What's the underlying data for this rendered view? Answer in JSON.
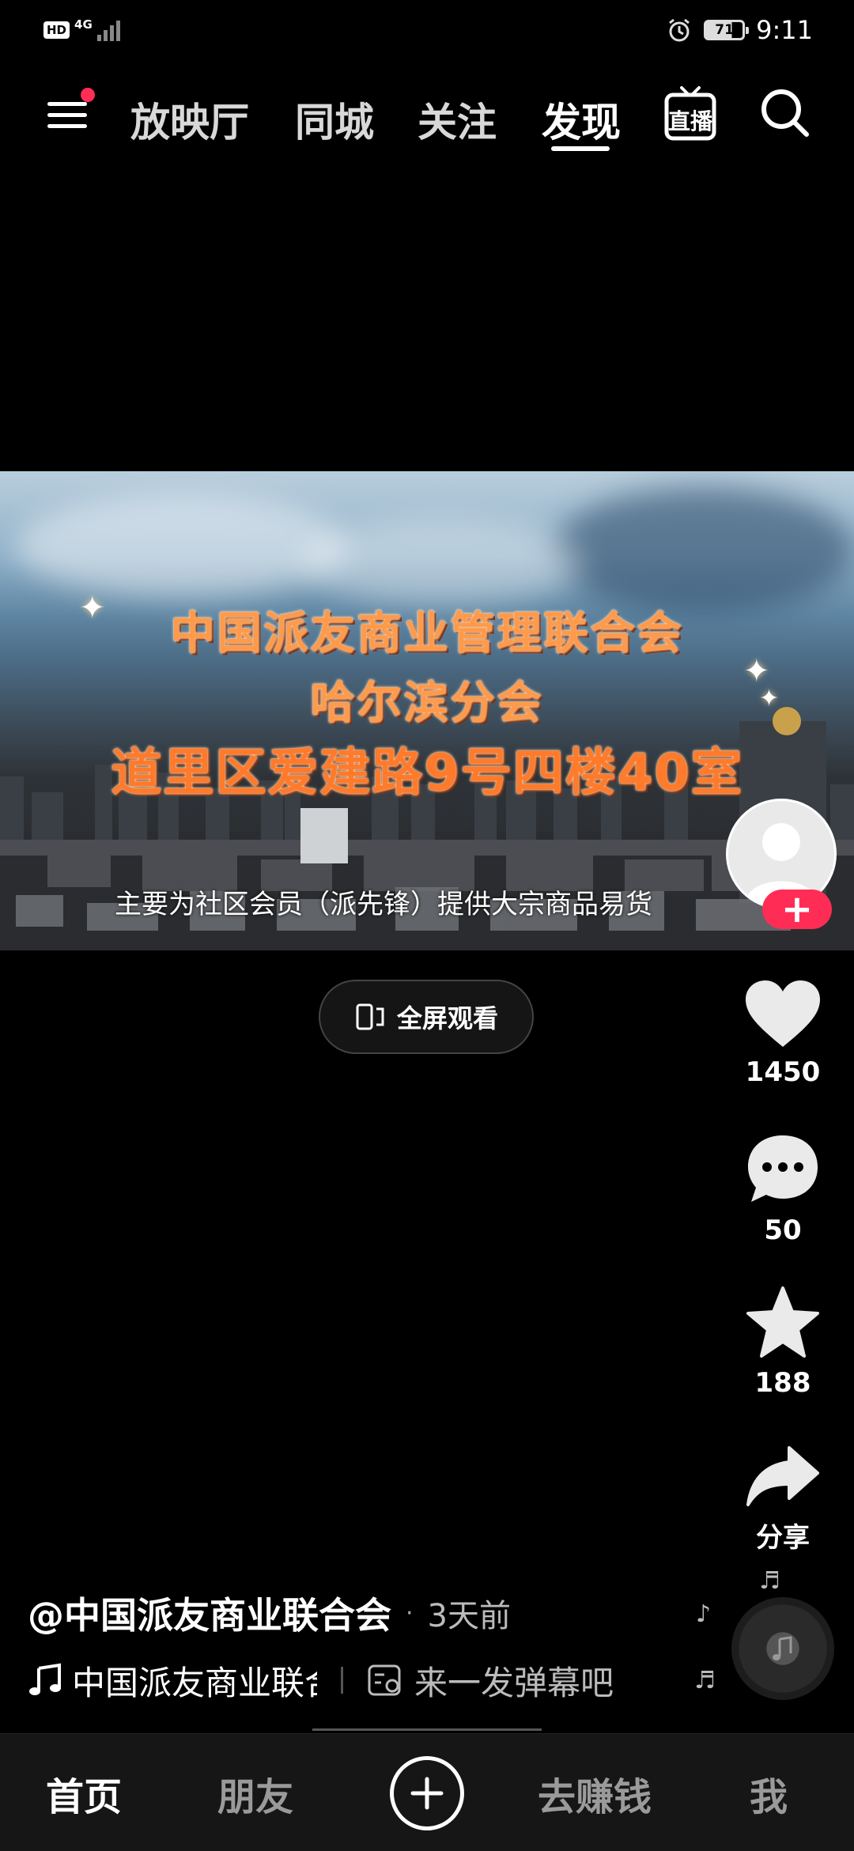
{
  "status_bar": {
    "hd": "HD",
    "network": "4G",
    "battery": "71",
    "time": "9:11"
  },
  "top_nav": {
    "tabs": [
      {
        "label": "放映厅",
        "active": false
      },
      {
        "label": "同城",
        "active": false
      },
      {
        "label": "关注",
        "active": false
      },
      {
        "label": "发现",
        "active": true
      }
    ],
    "live_label": "直播"
  },
  "video": {
    "overlay_line1": "中国派友商业管理联合会",
    "overlay_line2": "哈尔滨分会",
    "overlay_line3": "道里区爱建路9号四楼40室",
    "subtitle": "主要为社区会员（派先锋）提供大宗商品易货"
  },
  "fullscreen_label": "全屏观看",
  "actions": {
    "likes": "1450",
    "comments": "50",
    "favorites": "188",
    "share_label": "分享"
  },
  "caption": {
    "author": "@中国派友商业联合会",
    "separator": "·",
    "time": "3天前",
    "music_title": "中国派友商业联合会",
    "danmaku_placeholder": "来一发弹幕吧"
  },
  "bottom_tabs": {
    "home": "首页",
    "friends": "朋友",
    "earn": "去赚钱",
    "me": "我"
  },
  "colors": {
    "accent": "#ff2d55",
    "background": "#000000",
    "overlay_text": "#ff9a4a"
  }
}
